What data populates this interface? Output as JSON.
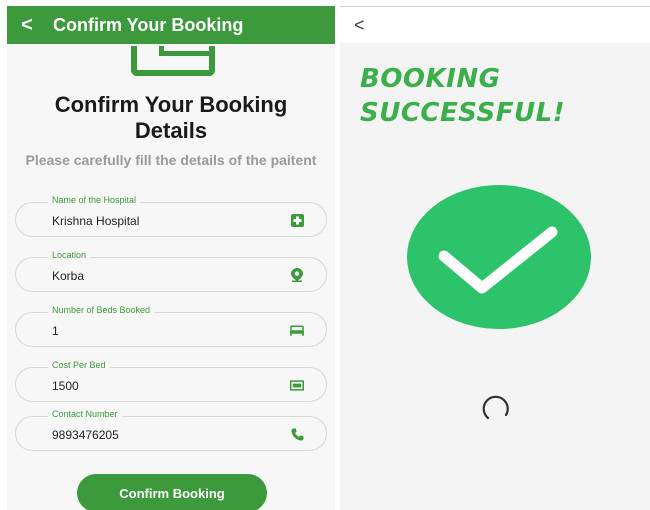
{
  "left": {
    "appbar": {
      "back_glyph": "<",
      "title": "Confirm Your Booking"
    },
    "heading": "Confirm Your Booking Details",
    "subheading": "Please carefully fill the details of the paitent",
    "fields": [
      {
        "label": "Name of the Hospital",
        "value": "Krishna Hospital",
        "icon": "hospital-icon"
      },
      {
        "label": "Location",
        "value": "Korba",
        "icon": "location-pin-icon"
      },
      {
        "label": "Number of Beds Booked",
        "value": "1",
        "icon": "bed-icon"
      },
      {
        "label": "Cost Per Bed",
        "value": "1500",
        "icon": "money-icon"
      },
      {
        "label": "Contact Number",
        "value": "9893476205",
        "icon": "phone-icon"
      }
    ],
    "confirm_button": "Confirm Booking"
  },
  "right": {
    "back_glyph": "<",
    "success_line1": "BOOKING",
    "success_line2": "SUCCESSFUL!",
    "status_icon": "checkmark-circle-icon",
    "loading_icon": "loading-spinner-icon"
  },
  "colors": {
    "primary_green": "#3c9a3c",
    "success_green": "#3bb04a",
    "check_circle": "#2dc36a"
  }
}
